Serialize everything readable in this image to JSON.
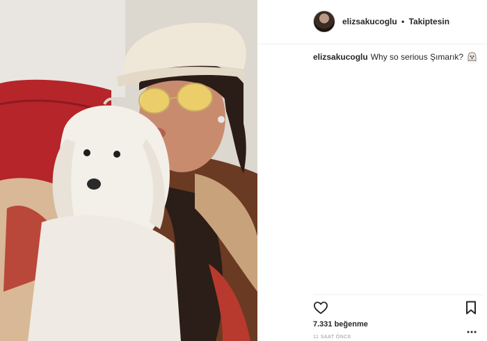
{
  "post": {
    "username": "elizsakucoglu",
    "separator": "•",
    "follow_status": "Takiptesin",
    "caption_user": "elizsakucoglu",
    "caption_text": "Why so serious Şımarık?",
    "likes_label": "7.331 beğenme",
    "timestamp": "11 SAAT ÖNCE"
  },
  "icons": {
    "like": "heart-icon",
    "save": "bookmark-icon",
    "more": "more-options-icon",
    "emoji": "ghost-emoji-icon"
  },
  "colors": {
    "text": "#262626",
    "muted": "#999999",
    "divider": "#efefef"
  }
}
